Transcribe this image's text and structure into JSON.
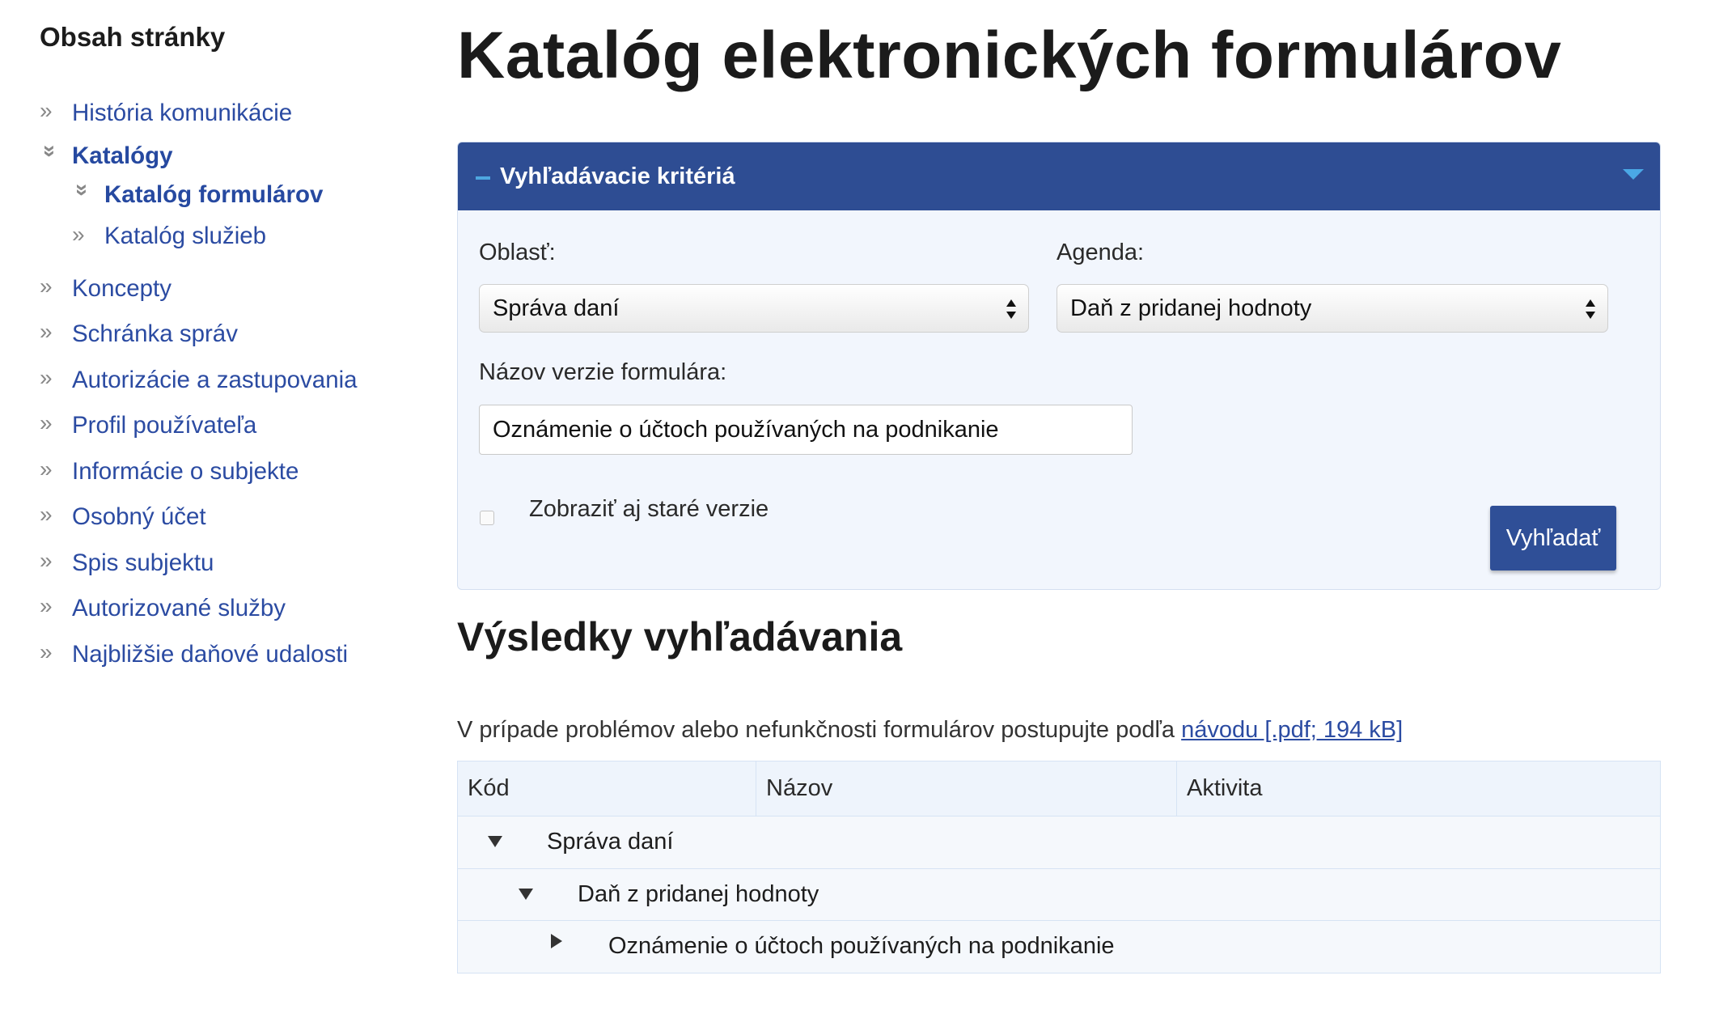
{
  "sidebar": {
    "title": "Obsah stránky",
    "items": [
      {
        "label": "História komunikácie"
      },
      {
        "label": "Katalógy"
      },
      {
        "label": "Koncepty"
      },
      {
        "label": "Schránka správ"
      },
      {
        "label": "Autorizácie a zastupovania"
      },
      {
        "label": "Profil používateľa"
      },
      {
        "label": "Informácie o subjekte"
      },
      {
        "label": "Osobný účet"
      },
      {
        "label": "Spis subjektu"
      },
      {
        "label": "Autorizované služby"
      },
      {
        "label": "Najbližšie daňové udalosti"
      }
    ],
    "sub_items": [
      {
        "label": "Katalóg formulárov"
      },
      {
        "label": "Katalóg služieb"
      }
    ]
  },
  "page": {
    "title": "Katalóg elektronických formulárov"
  },
  "search_panel": {
    "title": "Vyhľadávacie kritériá",
    "area_label": "Oblasť:",
    "area_value": "Správa daní",
    "agenda_label": "Agenda:",
    "agenda_value": "Daň z pridanej hodnoty",
    "form_name_label": "Názov verzie formulára:",
    "form_name_value": "Oznámenie o účtoch používaných na podnikanie",
    "old_versions_label": "Zobraziť aj staré verzie",
    "old_versions_checked": false,
    "search_button": "Vyhľadať"
  },
  "results": {
    "title": "Výsledky vyhľadávania",
    "hint_text": "V prípade problémov alebo nefunkčnosti formulárov postupujte podľa ",
    "hint_link": "návodu [.pdf; 194 kB]",
    "columns": [
      "Kód",
      "Názov",
      "Aktivita"
    ],
    "rows": [
      {
        "label": "Správa daní",
        "expanded": true
      },
      {
        "label": "Daň z pridanej hodnoty",
        "expanded": true
      },
      {
        "label": "Oznámenie o účtoch používaných na podnikanie",
        "expanded": false
      }
    ]
  },
  "colors": {
    "link": "#2b4ba2",
    "panel_header": "#2e4d93",
    "panel_bg": "#f2f6fd",
    "button": "#2f4f97",
    "accent_icon": "#4aa8e6"
  }
}
